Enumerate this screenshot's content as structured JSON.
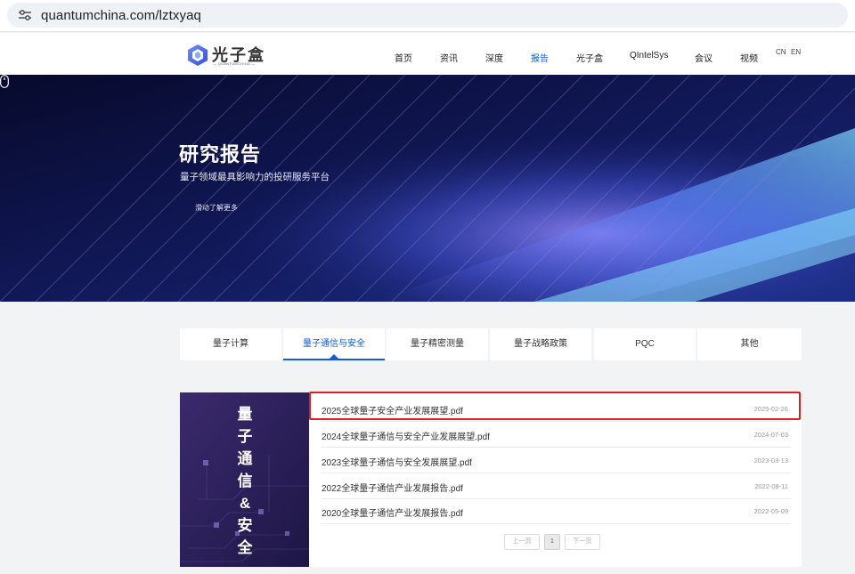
{
  "browser": {
    "url": "quantumchina.com/lztxyaq",
    "site_info_icon": "tune-icon"
  },
  "header": {
    "logo": {
      "text": "光子盒",
      "subtext": "— QUANTUMCHINA —"
    },
    "nav": [
      {
        "label": "首页"
      },
      {
        "label": "资讯"
      },
      {
        "label": "深度"
      },
      {
        "label": "报告",
        "active": true
      },
      {
        "label": "光子盒"
      },
      {
        "label": "QIntelSys"
      },
      {
        "label": "会议"
      },
      {
        "label": "视频"
      }
    ],
    "lang": {
      "cn": "CN",
      "en": "EN"
    },
    "active_color": "#1559d6"
  },
  "banner": {
    "title": "研究报告",
    "subtitle": "量子领域最具影响力的投研服务平台",
    "scroll_hint": "滑动了解更多",
    "scroll_icon": "mouse-icon"
  },
  "tabs": [
    {
      "label": "量子计算"
    },
    {
      "label": "量子通信与安全",
      "active": true
    },
    {
      "label": "量子精密测量"
    },
    {
      "label": "量子战略政策"
    },
    {
      "label": "PQC"
    },
    {
      "label": "其他"
    }
  ],
  "side_panel": {
    "title": "量子通信&安全"
  },
  "documents": [
    {
      "name": "2025全球量子安全产业发展展望.pdf",
      "date": "2025-02-26",
      "highlighted": true
    },
    {
      "name": "2024全球量子通信与安全产业发展展望.pdf",
      "date": "2024-07-03"
    },
    {
      "name": "2023全球量子通信与安全发展展望.pdf",
      "date": "2023-03-13"
    },
    {
      "name": "2022全球量子通信产业发展报告.pdf",
      "date": "2022-08-11"
    },
    {
      "name": "2020全球量子通信产业发展报告.pdf",
      "date": "2022-05-09"
    }
  ],
  "pagination": {
    "prev": "上一页",
    "current": "1",
    "next": "下一页"
  },
  "colors": {
    "highlight_border": "#e02020",
    "banner_bg": "#0b0f3a"
  }
}
